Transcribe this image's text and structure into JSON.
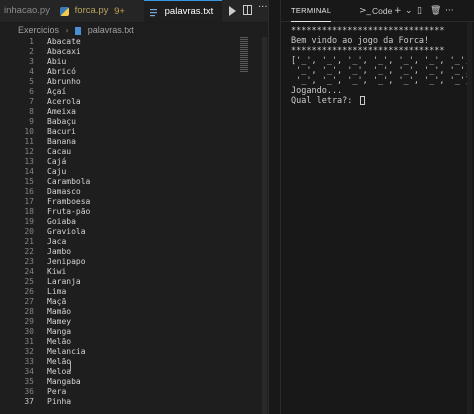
{
  "editor": {
    "tabs": [
      {
        "label": "inhacao.py"
      },
      {
        "label": "forca.py",
        "badge": "9+"
      },
      {
        "label": "palavras.txt"
      }
    ],
    "breadcrumb": {
      "folder": "Exercicios",
      "file": "palavras.txt"
    },
    "lines": [
      {
        "n": "1",
        "text": "Abacate"
      },
      {
        "n": "2",
        "text": "Abacaxi"
      },
      {
        "n": "3",
        "text": "Abiu"
      },
      {
        "n": "4",
        "text": "Abricó"
      },
      {
        "n": "5",
        "text": "Abrunho"
      },
      {
        "n": "6",
        "text": "Açaí"
      },
      {
        "n": "7",
        "text": "Acerola"
      },
      {
        "n": "8",
        "text": "Ameixa"
      },
      {
        "n": "9",
        "text": "Babaçu"
      },
      {
        "n": "10",
        "text": "Bacuri"
      },
      {
        "n": "11",
        "text": "Banana"
      },
      {
        "n": "12",
        "text": "Cacau"
      },
      {
        "n": "13",
        "text": "Cajá"
      },
      {
        "n": "14",
        "text": "Caju"
      },
      {
        "n": "15",
        "text": "Carambola"
      },
      {
        "n": "16",
        "text": "Damasco"
      },
      {
        "n": "17",
        "text": "Framboesa"
      },
      {
        "n": "18",
        "text": "Fruta-pão"
      },
      {
        "n": "19",
        "text": "Goiaba"
      },
      {
        "n": "20",
        "text": "Graviola"
      },
      {
        "n": "21",
        "text": "Jaca"
      },
      {
        "n": "22",
        "text": "Jambo"
      },
      {
        "n": "23",
        "text": "Jenipapo"
      },
      {
        "n": "24",
        "text": "Kiwi"
      },
      {
        "n": "25",
        "text": "Laranja"
      },
      {
        "n": "26",
        "text": "Lima"
      },
      {
        "n": "27",
        "text": "Maçã"
      },
      {
        "n": "28",
        "text": "Mamão"
      },
      {
        "n": "29",
        "text": "Mamey"
      },
      {
        "n": "30",
        "text": "Manga"
      },
      {
        "n": "31",
        "text": "Melão"
      },
      {
        "n": "32",
        "text": "Melancia"
      },
      {
        "n": "33",
        "text": "Melão"
      },
      {
        "n": "34",
        "text": "Meloa"
      },
      {
        "n": "35",
        "text": "Mangaba"
      },
      {
        "n": "36",
        "text": "Pera"
      },
      {
        "n": "37",
        "text": "Pinha"
      }
    ]
  },
  "terminal": {
    "tab_label": "TERMINAL",
    "shell_label": "Code",
    "icons": [
      "terminal-icon",
      "plus-icon",
      "chevron-down-icon",
      "split-icon",
      "trash-icon",
      "more-icon"
    ],
    "output": [
      "******************************",
      "Bem vindo ao jogo da Forca!",
      "******************************",
      "['_', '_', '_', '_', '_', '_', '_',",
      " '_', '_', '_', '_', '_', '_', '_',",
      " '_', '_', '_', '_', '_', '_', '_']",
      "Jogando...",
      "Qual letra?: "
    ]
  },
  "colors": {
    "accent": "#3a96dd",
    "editor_bg": "#1e1e1e",
    "terminal_bg": "#181818"
  }
}
